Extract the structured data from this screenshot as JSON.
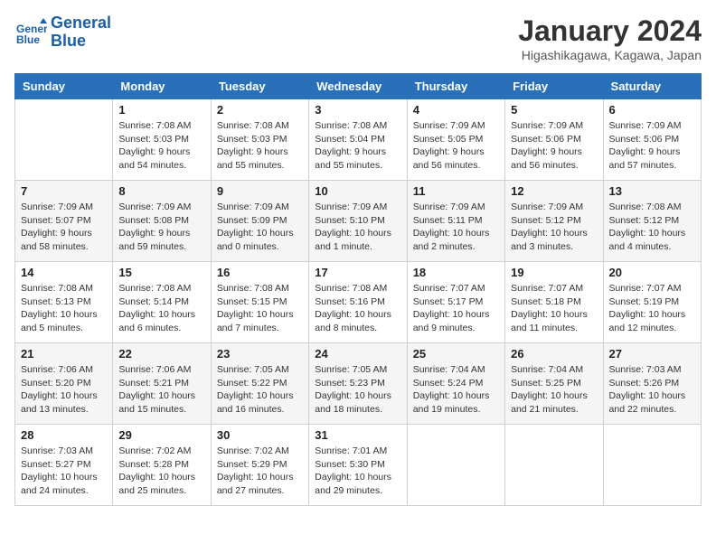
{
  "header": {
    "logo_line1": "General",
    "logo_line2": "Blue",
    "month": "January 2024",
    "location": "Higashikagawa, Kagawa, Japan"
  },
  "days_of_week": [
    "Sunday",
    "Monday",
    "Tuesday",
    "Wednesday",
    "Thursday",
    "Friday",
    "Saturday"
  ],
  "weeks": [
    [
      {
        "day": "",
        "sunrise": "",
        "sunset": "",
        "daylight": ""
      },
      {
        "day": "1",
        "sunrise": "Sunrise: 7:08 AM",
        "sunset": "Sunset: 5:03 PM",
        "daylight": "Daylight: 9 hours and 54 minutes."
      },
      {
        "day": "2",
        "sunrise": "Sunrise: 7:08 AM",
        "sunset": "Sunset: 5:03 PM",
        "daylight": "Daylight: 9 hours and 55 minutes."
      },
      {
        "day": "3",
        "sunrise": "Sunrise: 7:08 AM",
        "sunset": "Sunset: 5:04 PM",
        "daylight": "Daylight: 9 hours and 55 minutes."
      },
      {
        "day": "4",
        "sunrise": "Sunrise: 7:09 AM",
        "sunset": "Sunset: 5:05 PM",
        "daylight": "Daylight: 9 hours and 56 minutes."
      },
      {
        "day": "5",
        "sunrise": "Sunrise: 7:09 AM",
        "sunset": "Sunset: 5:06 PM",
        "daylight": "Daylight: 9 hours and 56 minutes."
      },
      {
        "day": "6",
        "sunrise": "Sunrise: 7:09 AM",
        "sunset": "Sunset: 5:06 PM",
        "daylight": "Daylight: 9 hours and 57 minutes."
      }
    ],
    [
      {
        "day": "7",
        "sunrise": "Sunrise: 7:09 AM",
        "sunset": "Sunset: 5:07 PM",
        "daylight": "Daylight: 9 hours and 58 minutes."
      },
      {
        "day": "8",
        "sunrise": "Sunrise: 7:09 AM",
        "sunset": "Sunset: 5:08 PM",
        "daylight": "Daylight: 9 hours and 59 minutes."
      },
      {
        "day": "9",
        "sunrise": "Sunrise: 7:09 AM",
        "sunset": "Sunset: 5:09 PM",
        "daylight": "Daylight: 10 hours and 0 minutes."
      },
      {
        "day": "10",
        "sunrise": "Sunrise: 7:09 AM",
        "sunset": "Sunset: 5:10 PM",
        "daylight": "Daylight: 10 hours and 1 minute."
      },
      {
        "day": "11",
        "sunrise": "Sunrise: 7:09 AM",
        "sunset": "Sunset: 5:11 PM",
        "daylight": "Daylight: 10 hours and 2 minutes."
      },
      {
        "day": "12",
        "sunrise": "Sunrise: 7:09 AM",
        "sunset": "Sunset: 5:12 PM",
        "daylight": "Daylight: 10 hours and 3 minutes."
      },
      {
        "day": "13",
        "sunrise": "Sunrise: 7:08 AM",
        "sunset": "Sunset: 5:12 PM",
        "daylight": "Daylight: 10 hours and 4 minutes."
      }
    ],
    [
      {
        "day": "14",
        "sunrise": "Sunrise: 7:08 AM",
        "sunset": "Sunset: 5:13 PM",
        "daylight": "Daylight: 10 hours and 5 minutes."
      },
      {
        "day": "15",
        "sunrise": "Sunrise: 7:08 AM",
        "sunset": "Sunset: 5:14 PM",
        "daylight": "Daylight: 10 hours and 6 minutes."
      },
      {
        "day": "16",
        "sunrise": "Sunrise: 7:08 AM",
        "sunset": "Sunset: 5:15 PM",
        "daylight": "Daylight: 10 hours and 7 minutes."
      },
      {
        "day": "17",
        "sunrise": "Sunrise: 7:08 AM",
        "sunset": "Sunset: 5:16 PM",
        "daylight": "Daylight: 10 hours and 8 minutes."
      },
      {
        "day": "18",
        "sunrise": "Sunrise: 7:07 AM",
        "sunset": "Sunset: 5:17 PM",
        "daylight": "Daylight: 10 hours and 9 minutes."
      },
      {
        "day": "19",
        "sunrise": "Sunrise: 7:07 AM",
        "sunset": "Sunset: 5:18 PM",
        "daylight": "Daylight: 10 hours and 11 minutes."
      },
      {
        "day": "20",
        "sunrise": "Sunrise: 7:07 AM",
        "sunset": "Sunset: 5:19 PM",
        "daylight": "Daylight: 10 hours and 12 minutes."
      }
    ],
    [
      {
        "day": "21",
        "sunrise": "Sunrise: 7:06 AM",
        "sunset": "Sunset: 5:20 PM",
        "daylight": "Daylight: 10 hours and 13 minutes."
      },
      {
        "day": "22",
        "sunrise": "Sunrise: 7:06 AM",
        "sunset": "Sunset: 5:21 PM",
        "daylight": "Daylight: 10 hours and 15 minutes."
      },
      {
        "day": "23",
        "sunrise": "Sunrise: 7:05 AM",
        "sunset": "Sunset: 5:22 PM",
        "daylight": "Daylight: 10 hours and 16 minutes."
      },
      {
        "day": "24",
        "sunrise": "Sunrise: 7:05 AM",
        "sunset": "Sunset: 5:23 PM",
        "daylight": "Daylight: 10 hours and 18 minutes."
      },
      {
        "day": "25",
        "sunrise": "Sunrise: 7:04 AM",
        "sunset": "Sunset: 5:24 PM",
        "daylight": "Daylight: 10 hours and 19 minutes."
      },
      {
        "day": "26",
        "sunrise": "Sunrise: 7:04 AM",
        "sunset": "Sunset: 5:25 PM",
        "daylight": "Daylight: 10 hours and 21 minutes."
      },
      {
        "day": "27",
        "sunrise": "Sunrise: 7:03 AM",
        "sunset": "Sunset: 5:26 PM",
        "daylight": "Daylight: 10 hours and 22 minutes."
      }
    ],
    [
      {
        "day": "28",
        "sunrise": "Sunrise: 7:03 AM",
        "sunset": "Sunset: 5:27 PM",
        "daylight": "Daylight: 10 hours and 24 minutes."
      },
      {
        "day": "29",
        "sunrise": "Sunrise: 7:02 AM",
        "sunset": "Sunset: 5:28 PM",
        "daylight": "Daylight: 10 hours and 25 minutes."
      },
      {
        "day": "30",
        "sunrise": "Sunrise: 7:02 AM",
        "sunset": "Sunset: 5:29 PM",
        "daylight": "Daylight: 10 hours and 27 minutes."
      },
      {
        "day": "31",
        "sunrise": "Sunrise: 7:01 AM",
        "sunset": "Sunset: 5:30 PM",
        "daylight": "Daylight: 10 hours and 29 minutes."
      },
      {
        "day": "",
        "sunrise": "",
        "sunset": "",
        "daylight": ""
      },
      {
        "day": "",
        "sunrise": "",
        "sunset": "",
        "daylight": ""
      },
      {
        "day": "",
        "sunrise": "",
        "sunset": "",
        "daylight": ""
      }
    ]
  ]
}
